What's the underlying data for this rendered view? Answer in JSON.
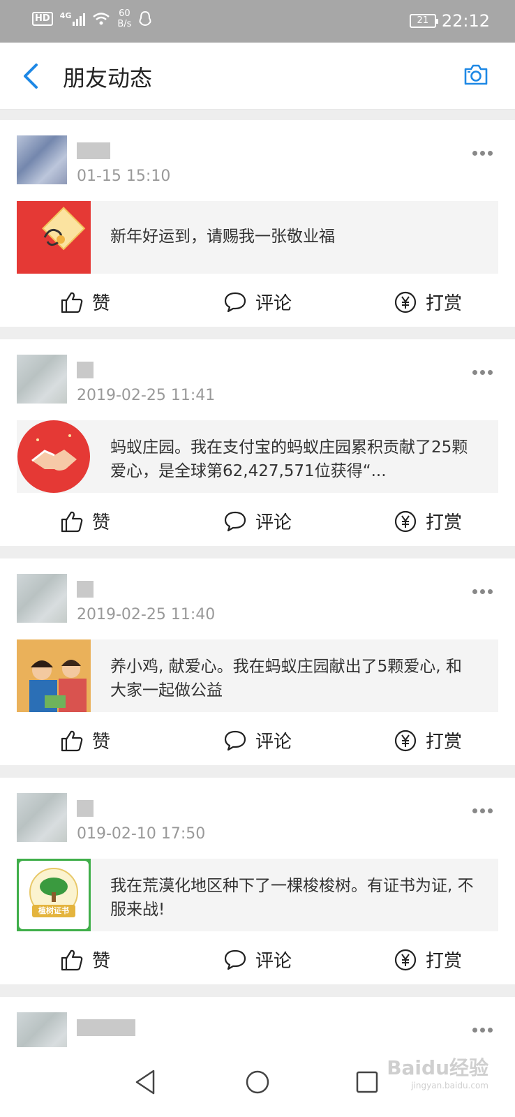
{
  "status_bar": {
    "hd": "HD",
    "network": "4G",
    "speed_value": "60",
    "speed_unit": "B/s",
    "battery": "21",
    "time": "22:12"
  },
  "header": {
    "title": "朋友动态",
    "back_icon": "chevron-left-icon",
    "camera_icon": "camera-icon"
  },
  "feed": [
    {
      "time": "01-15 15:10",
      "text": "新年好运到，请赐我一张敬业福",
      "thumb": "fortune-card",
      "actions": {
        "like": "赞",
        "comment": "评论",
        "reward": "打赏"
      }
    },
    {
      "time": "2019-02-25 11:41",
      "text": "蚂蚁庄园。我在支付宝的蚂蚁庄园累积贡献了25颗爱心，是全球第62,427,571位获得“...",
      "thumb": "handshake",
      "actions": {
        "like": "赞",
        "comment": "评论",
        "reward": "打赏"
      }
    },
    {
      "time": "2019-02-25 11:40",
      "text": "养小鸡, 献爱心。我在蚂蚁庄园献出了5颗爱心, 和大家一起做公益",
      "thumb": "kids-photo",
      "actions": {
        "like": "赞",
        "comment": "评论",
        "reward": "打赏"
      }
    },
    {
      "time": "019-02-10 17:50",
      "text": "我在荒漠化地区种下了一棵梭梭树。有证书为证, 不服来战!",
      "thumb": "tree-certificate",
      "thumb_label": "植树证书",
      "actions": {
        "like": "赞",
        "comment": "评论",
        "reward": "打赏"
      }
    }
  ],
  "watermark": {
    "brand": "Baidu经验",
    "url": "jingyan.baidu.com"
  },
  "colors": {
    "accent": "#1e88e5",
    "status_bar": "#a7a7a7",
    "background": "#eeeeee"
  }
}
